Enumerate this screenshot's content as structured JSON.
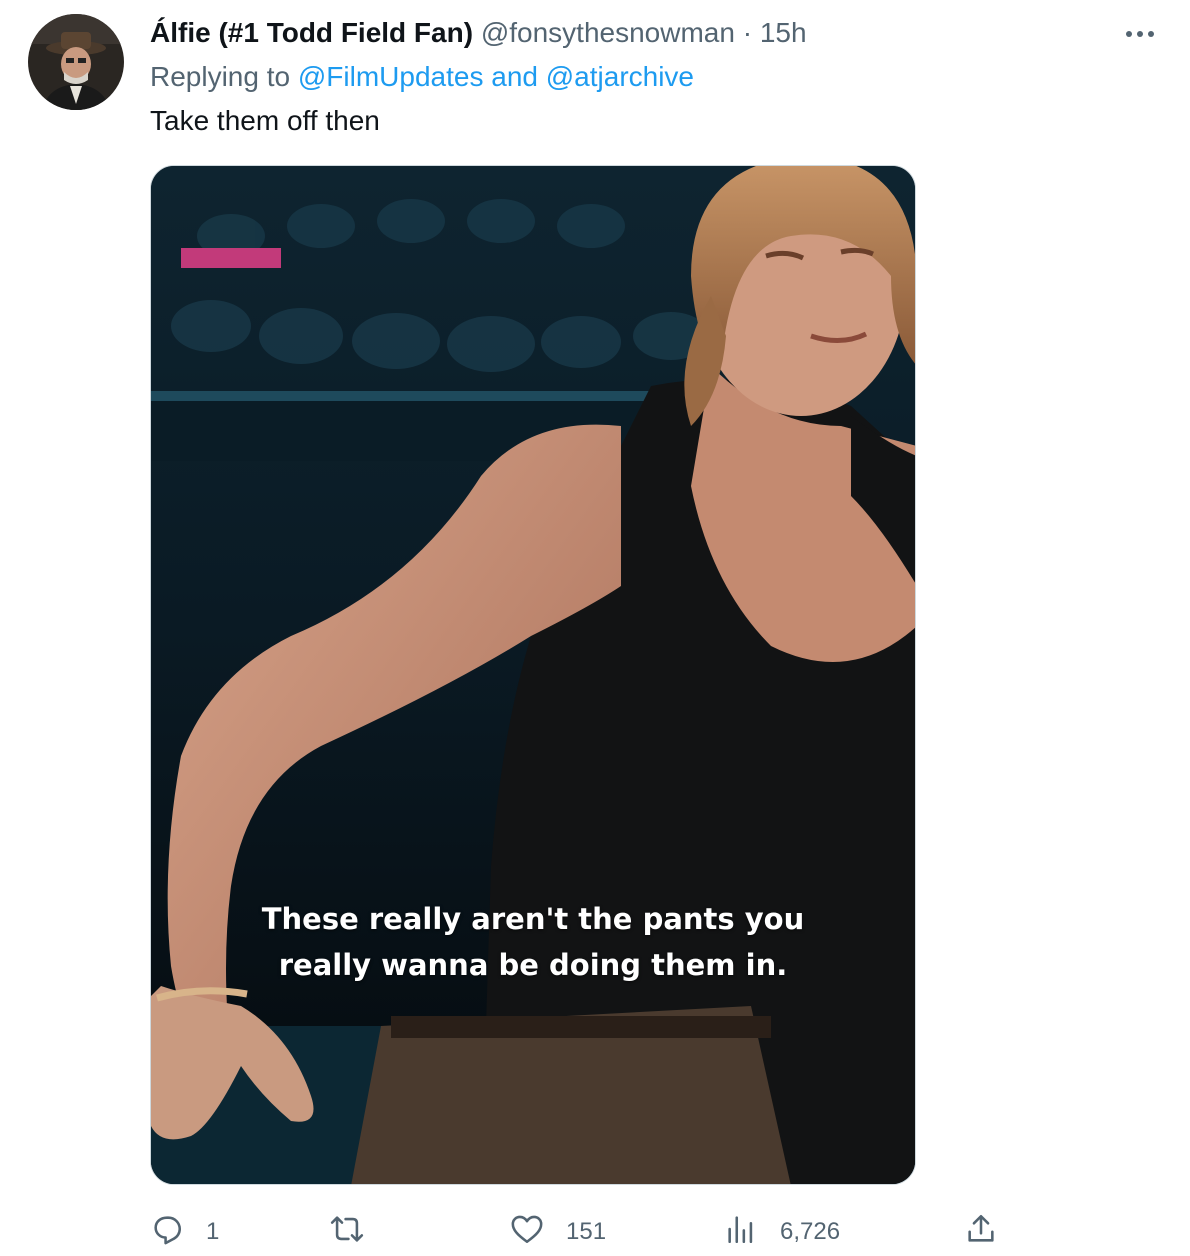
{
  "tweet": {
    "display_name": "Álfie (#1 Todd Field Fan)",
    "handle": "@fonsythesnowman",
    "separator": "·",
    "time": "15h",
    "replying_to_prefix": "Replying to",
    "mention_1": "@FilmUpdates",
    "mention_joiner": "and",
    "mention_2": "@atjarchive",
    "text": "Take them off then"
  },
  "media": {
    "caption_line_1": "These really aren't the pants you",
    "caption_line_2": "really wanna be doing them in."
  },
  "actions": {
    "reply_icon": "reply-icon",
    "reply_count": "1",
    "retweet_icon": "retweet-icon",
    "retweet_count": "",
    "like_icon": "heart-icon",
    "like_count": "151",
    "views_icon": "views-icon",
    "views_count": "6,726",
    "share_icon": "share-icon"
  },
  "colors": {
    "link": "#1d9bf0",
    "secondary_text": "#536471",
    "primary_text": "#0f1419"
  }
}
